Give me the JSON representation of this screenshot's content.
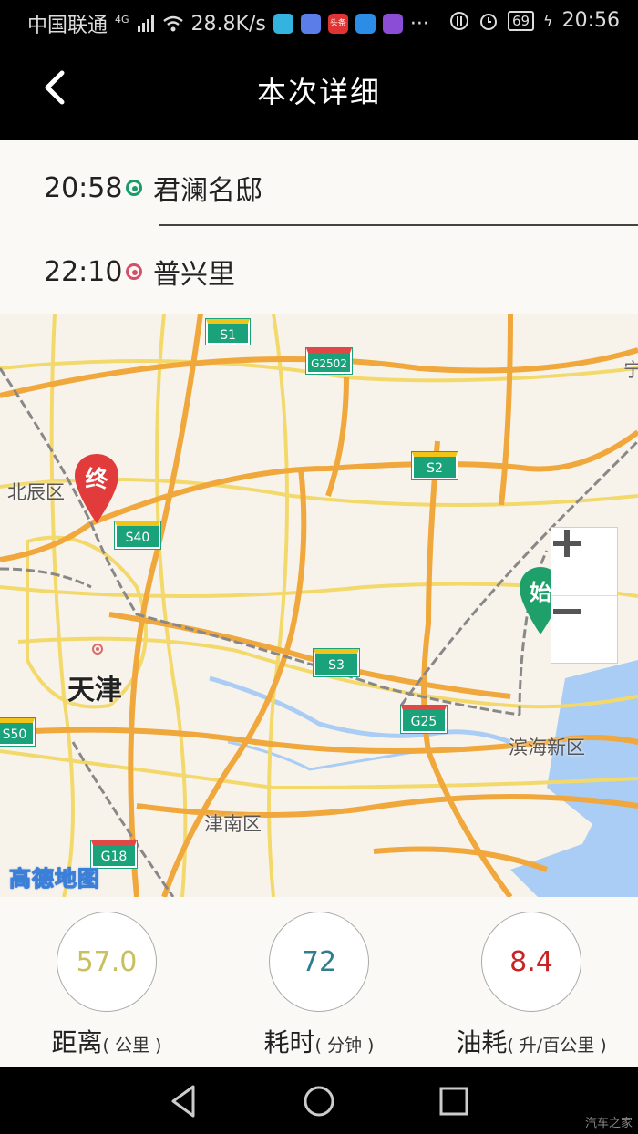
{
  "status_bar": {
    "carrier": "中国联通",
    "network": "4G",
    "speed": "28.8K/s",
    "battery": "69",
    "time": "20:56",
    "app_badge": "头条"
  },
  "header": {
    "title": "本次详细"
  },
  "route": {
    "start": {
      "time": "20:58",
      "place": "君澜名邸"
    },
    "end": {
      "time": "22:10",
      "place": "普兴里"
    }
  },
  "map": {
    "labels": {
      "tianjin": "天津",
      "beichen": "北辰区",
      "jinnan": "津南区",
      "binhai": "滨海新区",
      "edge": "宁"
    },
    "road_shields": {
      "s1": "S1",
      "g2502": "G2502",
      "s2": "S2",
      "s40": "S40",
      "s3": "S3",
      "g25": "G25",
      "s50": "S50",
      "g18": "G18"
    },
    "markers": {
      "start": "始",
      "end": "终"
    },
    "logo": "高德地图"
  },
  "stats": {
    "distance": {
      "value": "57.0",
      "label": "距离",
      "unit": "( 公里 )",
      "color": "#c8c060"
    },
    "duration": {
      "value": "72",
      "label": "耗时",
      "unit": "( 分钟 )",
      "color": "#2f7e8f"
    },
    "fuel": {
      "value": "8.4",
      "label": "油耗",
      "unit": "( 升/百公里 )",
      "color": "#c82424"
    }
  },
  "watermark": "汽车之家"
}
